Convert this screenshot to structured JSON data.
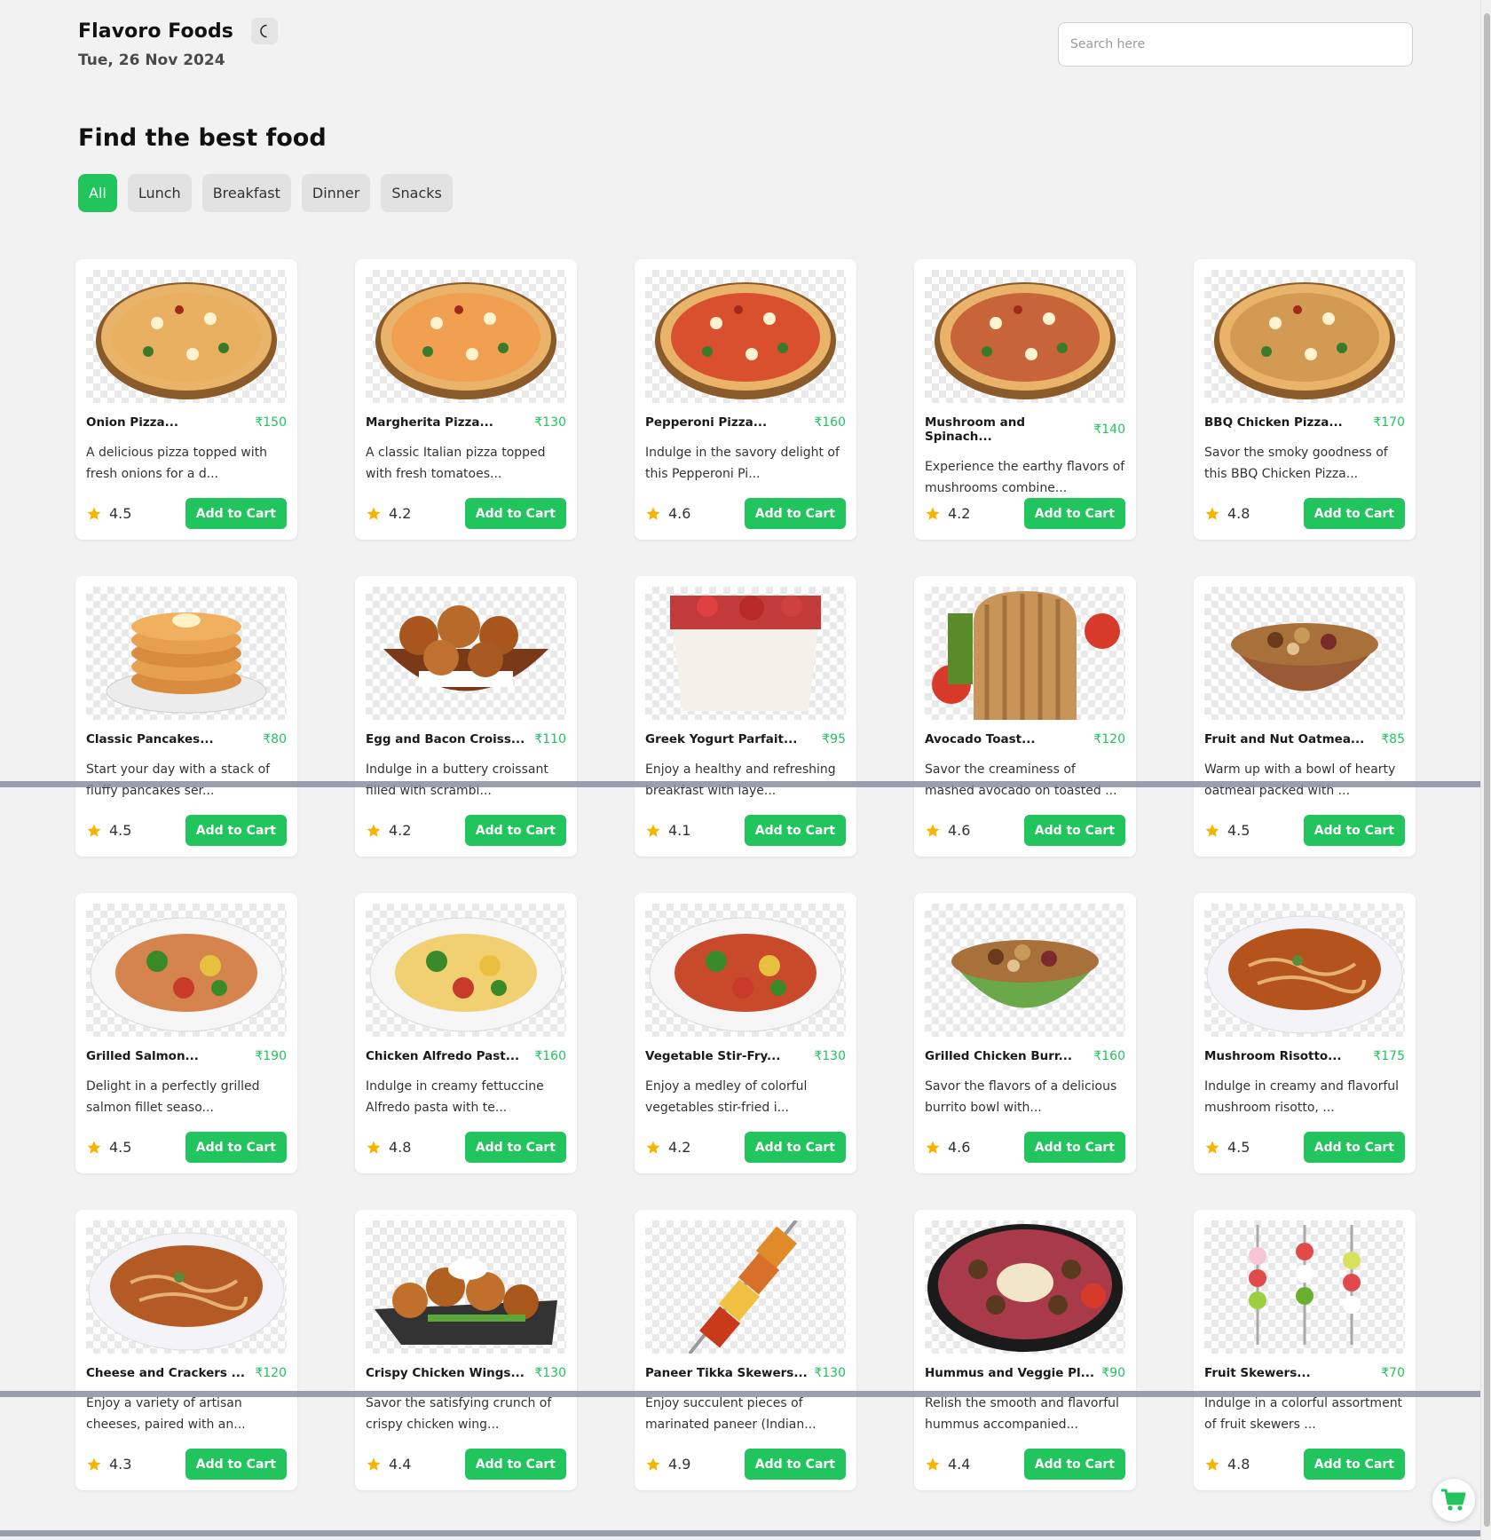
{
  "app": {
    "brand": "Flavoro Foods",
    "date": "Tue, 26 Nov 2024",
    "theme_icon": "moon-icon"
  },
  "search": {
    "placeholder": "Search here",
    "value": ""
  },
  "main": {
    "heading": "Find the best food",
    "categories": [
      {
        "label": "All",
        "active": true
      },
      {
        "label": "Lunch",
        "active": false
      },
      {
        "label": "Breakfast",
        "active": false
      },
      {
        "label": "Dinner",
        "active": false
      },
      {
        "label": "Snacks",
        "active": false
      }
    ],
    "add_label": "Add to Cart",
    "items": [
      {
        "name": "Onion Pizza...",
        "price": "₹150",
        "desc": "A delicious pizza topped with fresh onions for a d...",
        "rating": "4.5",
        "art": "pizza",
        "c": "#e8b060"
      },
      {
        "name": "Margherita Pizza...",
        "price": "₹130",
        "desc": "A classic Italian pizza topped with fresh tomatoes...",
        "rating": "4.2",
        "art": "pizza",
        "c": "#f0a050"
      },
      {
        "name": "Pepperoni Pizza...",
        "price": "₹160",
        "desc": "Indulge in the savory delight of this Pepperoni Pi...",
        "rating": "4.6",
        "art": "pizza",
        "c": "#d9502e"
      },
      {
        "name": "Mushroom and Spinach...",
        "price": "₹140",
        "desc": "Experience the earthy flavors of mushrooms combine...",
        "rating": "4.2",
        "art": "pizza",
        "c": "#c8643a"
      },
      {
        "name": "BBQ Chicken Pizza...",
        "price": "₹170",
        "desc": "Savor the smoky goodness of this BBQ Chicken Pizza...",
        "rating": "4.8",
        "art": "pizza",
        "c": "#d29a52"
      },
      {
        "name": "Classic Pancakes...",
        "price": "₹80",
        "desc": "Start your day with a stack of fluffy pancakes ser...",
        "rating": "4.5",
        "art": "stack",
        "c": "#d98c3e"
      },
      {
        "name": "Egg and Bacon Croiss...",
        "price": "₹110",
        "desc": "Indulge in a buttery croissant filled with scrambl...",
        "rating": "4.2",
        "art": "basket",
        "c": "#a8561e"
      },
      {
        "name": "Greek Yogurt Parfait...",
        "price": "₹95",
        "desc": "Enjoy a healthy and refreshing breakfast with laye...",
        "rating": "4.1",
        "art": "cup",
        "c": "#c23a3a"
      },
      {
        "name": "Avocado Toast...",
        "price": "₹120",
        "desc": "Savor the creaminess of mashed avocado on toasted ...",
        "rating": "4.6",
        "art": "toast",
        "c": "#c99458"
      },
      {
        "name": "Fruit and Nut Oatmea...",
        "price": "₹85",
        "desc": "Warm up with a bowl of hearty oatmeal packed with ...",
        "rating": "4.5",
        "art": "bowl",
        "c": "#9a5a36"
      },
      {
        "name": "Grilled Salmon...",
        "price": "₹190",
        "desc": "Delight in a perfectly grilled salmon fillet seaso...",
        "rating": "4.5",
        "art": "plate",
        "c": "#d6844e"
      },
      {
        "name": "Chicken Alfredo Past...",
        "price": "₹160",
        "desc": "Indulge in creamy fettuccine Alfredo pasta with te...",
        "rating": "4.8",
        "art": "plate",
        "c": "#f0d070"
      },
      {
        "name": "Vegetable Stir-Fry...",
        "price": "₹130",
        "desc": "Enjoy a medley of colorful vegetables stir-fried i...",
        "rating": "4.2",
        "art": "plate",
        "c": "#c94a2a"
      },
      {
        "name": "Grilled Chicken Burr...",
        "price": "₹160",
        "desc": "Savor the flavors of a delicious burrito bowl with...",
        "rating": "4.6",
        "art": "bowl",
        "c": "#6aa84a"
      },
      {
        "name": "Mushroom Risotto...",
        "price": "₹175",
        "desc": "Indulge in creamy and flavorful mushroom risotto, ...",
        "rating": "4.5",
        "art": "soup",
        "c": "#b4541c"
      },
      {
        "name": "Cheese and Crackers ...",
        "price": "₹120",
        "desc": "Enjoy a variety of artisan cheeses, paired with an...",
        "rating": "4.3",
        "art": "soup",
        "c": "#b45a24"
      },
      {
        "name": "Crispy Chicken Wings...",
        "price": "₹130",
        "desc": "Savor the satisfying crunch of crispy chicken wing...",
        "rating": "4.4",
        "art": "tray",
        "c": "#c0702a"
      },
      {
        "name": "Paneer Tikka Skewers...",
        "price": "₹130",
        "desc": "Enjoy succulent pieces of marinated paneer (Indian...",
        "rating": "4.9",
        "art": "skewer",
        "c": "#e08a2a"
      },
      {
        "name": "Hummus and Veggie Pl...",
        "price": "₹90",
        "desc": "Relish the smooth and flavorful hummus accompanied...",
        "rating": "4.4",
        "art": "platter",
        "c": "#5a3a1e"
      },
      {
        "name": "Fruit Skewers...",
        "price": "₹70",
        "desc": "Indulge in a colorful assortment of fruit skewers ...",
        "rating": "4.8",
        "art": "fruit",
        "c": "#e04a4a"
      }
    ]
  },
  "colors": {
    "accent": "#21c45d",
    "background": "#f2f2f2"
  },
  "floating_cart": {
    "icon": "cart-icon"
  }
}
